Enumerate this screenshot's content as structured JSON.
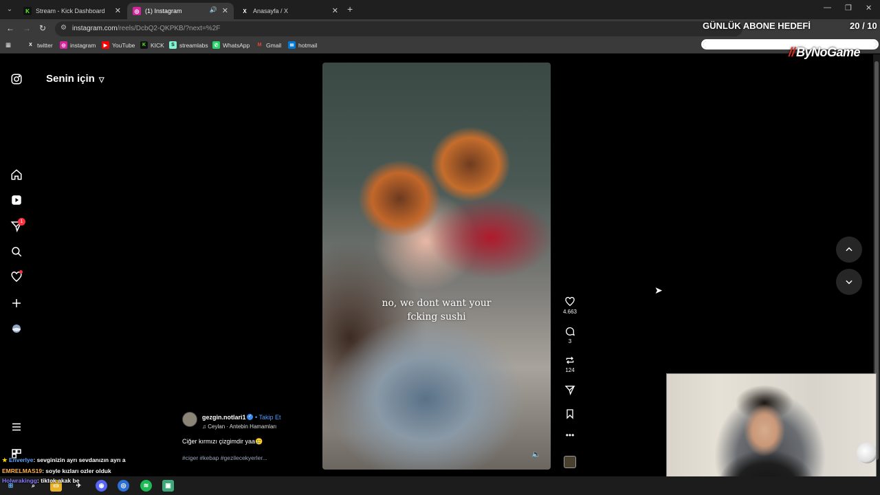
{
  "browser": {
    "tabs": [
      {
        "title": "Stream - Kick Dashboard",
        "icon": "K",
        "color": "#53fc18"
      },
      {
        "title": "(1) Instagram",
        "icon": "◎",
        "color": "#d6249f"
      },
      {
        "title": "Anasayfa / X",
        "icon": "X",
        "color": "#ffffff"
      }
    ],
    "url_host": "instagram.com",
    "url_path": "/reels/DcbQ2-QKPKB/?next=%2F",
    "bookmarks": [
      {
        "label": "twitter",
        "icon": "X",
        "color": "#000000"
      },
      {
        "label": "instagram",
        "icon": "◎",
        "color": "#d6249f"
      },
      {
        "label": "YouTube",
        "icon": "▶",
        "color": "#ff0000"
      },
      {
        "label": "KICK",
        "icon": "K",
        "color": "#53fc18"
      },
      {
        "label": "streamlabs",
        "icon": "S",
        "color": "#80f5d2"
      },
      {
        "label": "WhatsApp",
        "icon": "✆",
        "color": "#25d366"
      },
      {
        "label": "Gmail",
        "icon": "M",
        "color": "#ea4335"
      },
      {
        "label": "hotmail",
        "icon": "✉",
        "color": "#0078d4"
      }
    ]
  },
  "overlay": {
    "goal_title": "GÜNLÜK ABONE HEDEFİ",
    "goal_count": "20 / 10",
    "goal_progress": 1.0,
    "brand": "ByNoGame"
  },
  "instagram": {
    "feed_title": "Senin için",
    "notification_count": "1",
    "reel": {
      "caption_line1": "no, we dont want your",
      "caption_line2": "fcking sushi",
      "username": "gezgin.notlari1",
      "follow_label": "Takip Et",
      "audio": "Ceylan · Antebin Hamamları",
      "description": "Ciğer kırmızı çizgimdir yaa🥲",
      "tags": "#ciger #kebap #gezilecekyerler...",
      "likes": "4.663",
      "comments": "3",
      "reposts": "124"
    }
  },
  "chat": [
    {
      "user": "Enverlye",
      "message": ": sevginizin ayrı sevdanızın ayrı a",
      "color": "#5fa8ff"
    },
    {
      "user": "EMRELMAS19",
      "message": ": soyle kızları ozler olduk",
      "color": "#ffb347"
    },
    {
      "user": "Holwrakingg",
      "message": ": tiktok akak be",
      "color": "#8a7cff"
    }
  ]
}
